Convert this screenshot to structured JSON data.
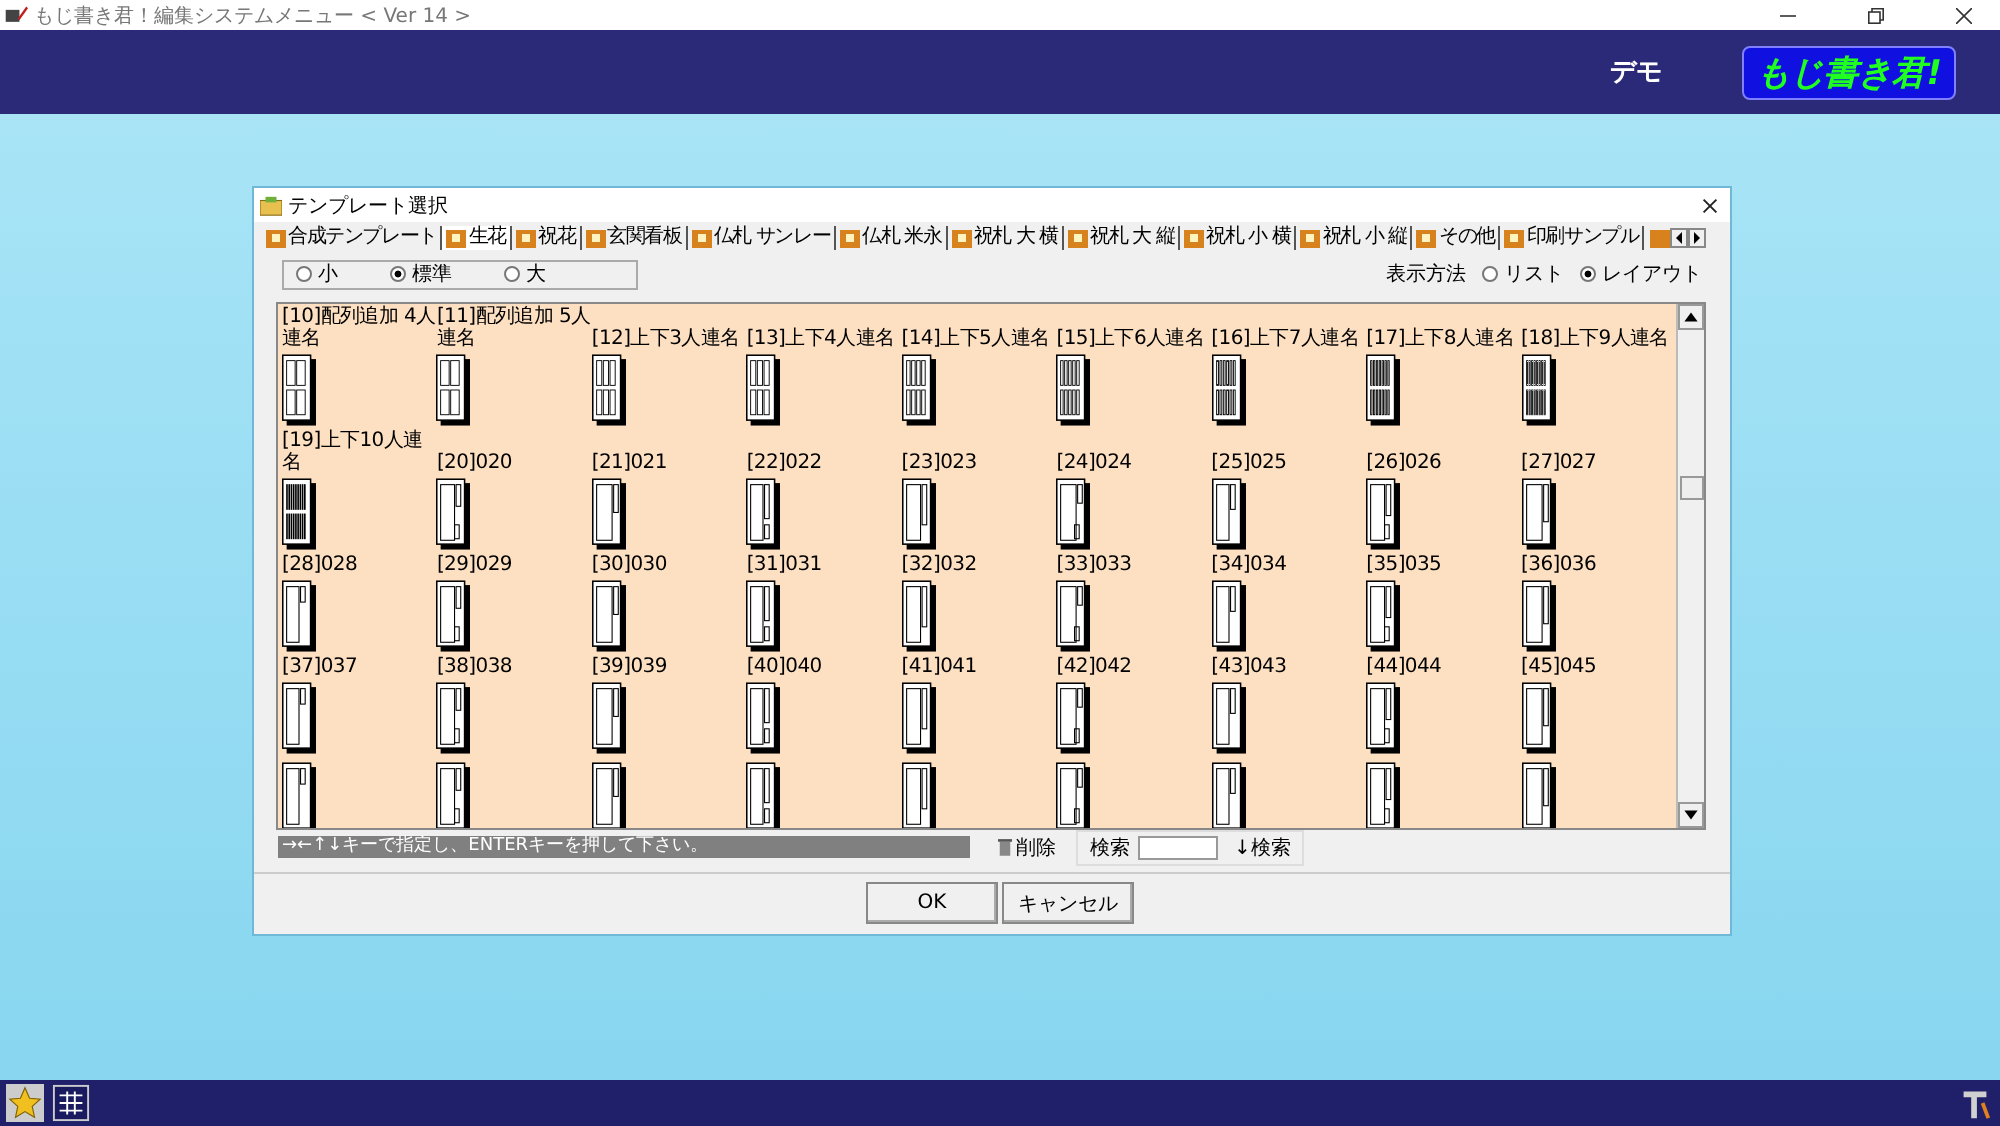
{
  "window": {
    "title": "もじ書き君！編集システムメニュー < Ver 14 >"
  },
  "header": {
    "demo_label": "デモ",
    "logo": "もじ書き君!"
  },
  "dialog": {
    "title": "テンプレート選択",
    "tabs": [
      {
        "label": "合成テンプレート",
        "selected": false
      },
      {
        "label": "生花",
        "selected": true
      },
      {
        "label": "祝花",
        "selected": false
      },
      {
        "label": "玄関看板",
        "selected": false
      },
      {
        "label": "仏札 サンレー",
        "selected": false
      },
      {
        "label": "仏札 米永",
        "selected": false
      },
      {
        "label": "祝札 大 横",
        "selected": false
      },
      {
        "label": "祝札 大 縦",
        "selected": false
      },
      {
        "label": "祝札 小 横",
        "selected": false
      },
      {
        "label": "祝札 小 縦",
        "selected": false
      },
      {
        "label": "その他",
        "selected": false
      },
      {
        "label": "印刷サンプル",
        "selected": false
      }
    ],
    "sizes": [
      {
        "label": "小",
        "selected": false
      },
      {
        "label": "標準",
        "selected": true
      },
      {
        "label": "大",
        "selected": false
      }
    ],
    "view_label": "表示方法",
    "views": [
      {
        "label": "リスト",
        "selected": false
      },
      {
        "label": "レイアウト",
        "selected": true
      }
    ],
    "templates": [
      {
        "label": "[10]配列追加 4人連名"
      },
      {
        "label": "[11]配列追加 5人連名"
      },
      {
        "label": "[12]上下3人連名"
      },
      {
        "label": "[13]上下4人連名"
      },
      {
        "label": "[14]上下5人連名"
      },
      {
        "label": "[15]上下6人連名"
      },
      {
        "label": "[16]上下7人連名"
      },
      {
        "label": "[17]上下8人連名"
      },
      {
        "label": "[18]上下9人連名"
      },
      {
        "label": "[19]上下10人連名"
      },
      {
        "label": "[20]020"
      },
      {
        "label": "[21]021"
      },
      {
        "label": "[22]022"
      },
      {
        "label": "[23]023"
      },
      {
        "label": "[24]024"
      },
      {
        "label": "[25]025"
      },
      {
        "label": "[26]026"
      },
      {
        "label": "[27]027"
      },
      {
        "label": "[28]028"
      },
      {
        "label": "[29]029"
      },
      {
        "label": "[30]030"
      },
      {
        "label": "[31]031"
      },
      {
        "label": "[32]032"
      },
      {
        "label": "[33]033"
      },
      {
        "label": "[34]034"
      },
      {
        "label": "[35]035"
      },
      {
        "label": "[36]036"
      },
      {
        "label": "[37]037"
      },
      {
        "label": "[38]038"
      },
      {
        "label": "[39]039"
      },
      {
        "label": "[40]040"
      },
      {
        "label": "[41]041"
      },
      {
        "label": "[42]042"
      },
      {
        "label": "[43]043"
      },
      {
        "label": "[44]044"
      },
      {
        "label": "[45]045"
      },
      {
        "kind": "thumbnail"
      },
      {
        "kind": "thumbnail"
      },
      {
        "kind": "thumbnail"
      },
      {
        "kind": "thumbnail"
      },
      {
        "kind": "thumbnail"
      },
      {
        "kind": "thumbnail"
      },
      {
        "kind": "thumbnail"
      },
      {
        "kind": "thumbnail"
      },
      {
        "kind": "thumbnail"
      }
    ],
    "status": "→←↑↓キーで指定し、ENTERキーを押して下さい。",
    "delete_button": "削除",
    "search_label": "検索",
    "search_button": "↓検索",
    "ok_button": "OK",
    "cancel_button": "キャンセル"
  }
}
